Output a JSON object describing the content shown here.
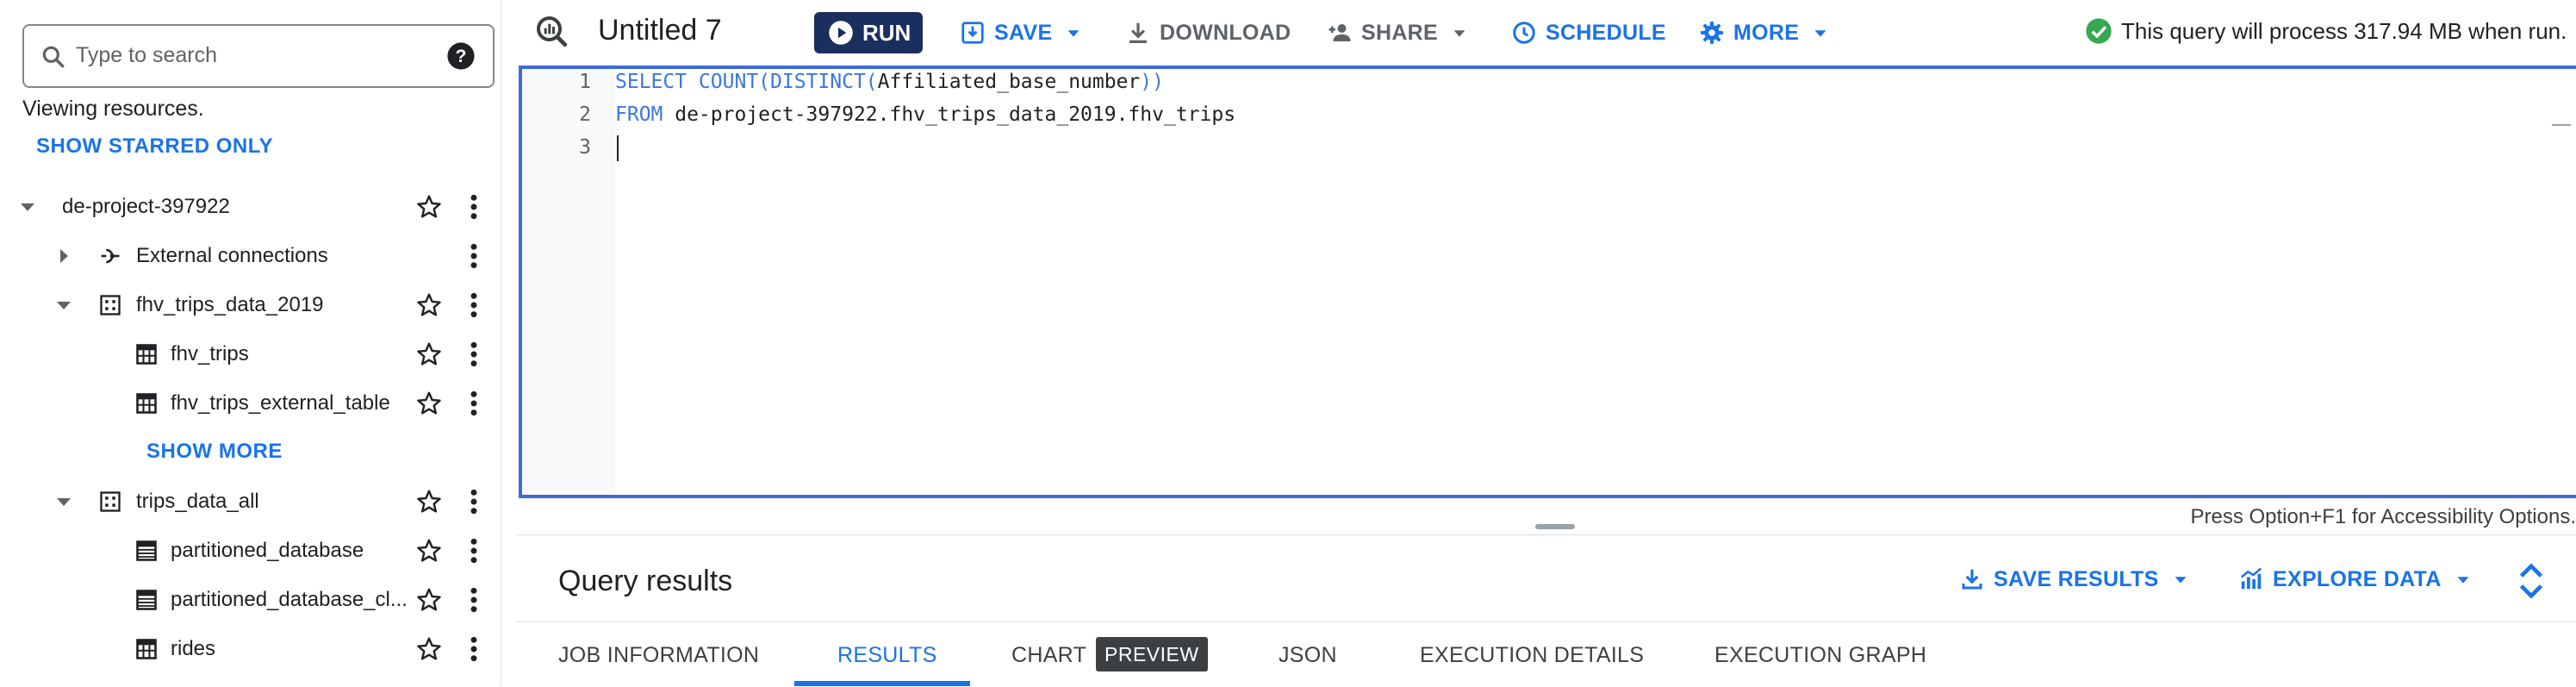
{
  "explorer": {
    "search_placeholder": "Type to search",
    "viewing_text": "Viewing resources.",
    "show_starred": "SHOW STARRED ONLY",
    "project": "de-project-397922",
    "external_connections": "External connections",
    "dataset1": "fhv_trips_data_2019",
    "dataset1_tables": [
      "fhv_trips",
      "fhv_trips_external_table"
    ],
    "show_more": "SHOW MORE",
    "dataset2": "trips_data_all",
    "dataset2_tables": [
      "partitioned_database",
      "partitioned_database_cl...",
      "rides"
    ]
  },
  "toolbar": {
    "title": "Untitled 7",
    "run": "RUN",
    "save": "SAVE",
    "download": "DOWNLOAD",
    "share": "SHARE",
    "schedule": "SCHEDULE",
    "more": "MORE",
    "status": "This query will process 317.94 MB when run."
  },
  "editor": {
    "line_numbers": [
      "1",
      "2",
      "3"
    ],
    "line1": {
      "kw1": "SELECT COUNT(DISTINCT(",
      "ident": "Affiliated_base_number",
      "kw2": "))"
    },
    "line2": {
      "kw": "FROM",
      "rest": " de-project-397922.fhv_trips_data_2019.fhv_trips"
    },
    "accessibility": "Press Option+F1 for Accessibility Options."
  },
  "results": {
    "title": "Query results",
    "save_results": "SAVE RESULTS",
    "explore_data": "EXPLORE DATA",
    "tabs": [
      "JOB INFORMATION",
      "RESULTS",
      "CHART",
      "JSON",
      "EXECUTION DETAILS",
      "EXECUTION GRAPH"
    ],
    "preview_badge": "PREVIEW",
    "active_tab": "RESULTS"
  },
  "colors": {
    "accent": "#1a73e8",
    "run_button": "#1b2f5e",
    "editor_border": "#3f6ad8",
    "success": "#34a853"
  }
}
